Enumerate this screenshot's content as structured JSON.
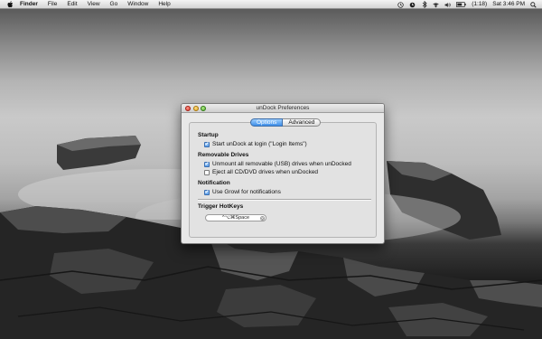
{
  "menubar": {
    "app_name": "Finder",
    "menus": [
      "File",
      "Edit",
      "View",
      "Go",
      "Window",
      "Help"
    ],
    "battery_text": "(1:18)",
    "clock": "Sat 3:46 PM",
    "icons": [
      "apple-icon",
      "time-machine-icon",
      "clock-icon",
      "bluetooth-icon",
      "wifi-icon",
      "volume-icon",
      "battery-icon",
      "spotlight-icon"
    ]
  },
  "window": {
    "title": "unDock Preferences",
    "tabs": [
      "Options",
      "Advanced"
    ],
    "selected_tab": "Options",
    "sections": {
      "startup": "Startup",
      "removable": "Removable Drives",
      "notification": "Notification",
      "hotkeys": "Trigger HotKeys"
    },
    "options": {
      "start_login": {
        "label": "Start unDock at login (\"Login Items\")",
        "checked": true
      },
      "unmount_usb": {
        "label": "Unmount all removable (USB) drives when unDocked",
        "checked": true
      },
      "eject_cd": {
        "label": "Eject all CD/DVD drives when unDocked",
        "checked": false
      },
      "growl": {
        "label": "Use Growl for notifications",
        "checked": true
      }
    },
    "hotkey_value": "^⌥⌘Space"
  },
  "colors": {
    "selected_tab": "#3d8ee8",
    "close": "#d8362a",
    "minimize": "#dfa21a",
    "zoom": "#52a92b"
  }
}
